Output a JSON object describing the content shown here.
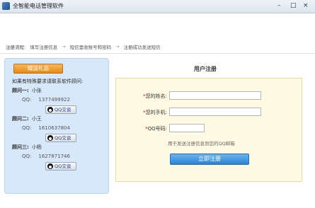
{
  "window": {
    "title": "全智能电话管理软件",
    "minimize": "–",
    "maximize": "□",
    "close": "×"
  },
  "steps": {
    "lead": "注册流程:",
    "items": [
      "填写注册信息",
      "短信里收账号和密码",
      "注册成功发送短信"
    ],
    "arrow": "→"
  },
  "sidebar": {
    "gift_label": "赠送礼品",
    "intro": "如果有特殊要求请联系软件顾问:",
    "qq_label": "QQ:",
    "qq_button": "QQ交谈",
    "advisors": [
      {
        "title": "顾问一:",
        "name": "小张",
        "qq": "1377499922"
      },
      {
        "title": "顾问二:",
        "name": "小王",
        "qq": "1610637804"
      },
      {
        "title": "顾问三:",
        "name": "小杨",
        "qq": "1627871746"
      }
    ]
  },
  "form": {
    "title": "用户注册",
    "fields": [
      {
        "label": "您的姓名:",
        "value": "",
        "required": "*"
      },
      {
        "label": "您的手机:",
        "value": "",
        "required": "*"
      },
      {
        "label": "QQ号码:",
        "value": "",
        "required": "*"
      }
    ],
    "hint": "用于发送注册信息到您的QQ邮箱",
    "submit_label": "立即注册"
  }
}
